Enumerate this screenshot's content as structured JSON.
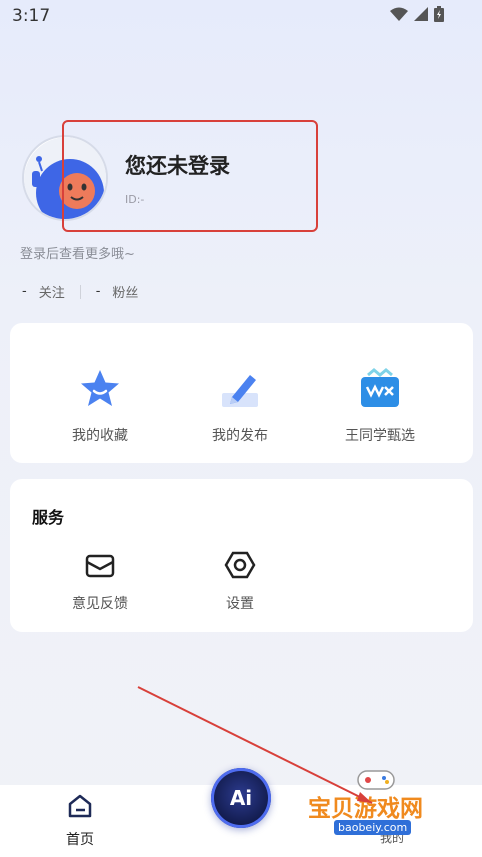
{
  "status_bar": {
    "time": "3:17"
  },
  "profile": {
    "name": "您还未登录",
    "id_label": "ID:-",
    "hint": "登录后查看更多哦~",
    "follow_count": "-",
    "follow_label": "关注",
    "fans_count": "-",
    "fans_label": "粉丝"
  },
  "quick_actions": [
    {
      "label": "我的收藏",
      "icon": "star-icon"
    },
    {
      "label": "我的发布",
      "icon": "pencil-icon"
    },
    {
      "label": "王同学甄选",
      "icon": "shopping-bag-icon"
    }
  ],
  "services": {
    "title": "服务",
    "items": [
      {
        "label": "意见反馈",
        "icon": "mail-icon"
      },
      {
        "label": "设置",
        "icon": "settings-icon"
      }
    ]
  },
  "bottom_nav": {
    "home_label": "首页",
    "ai_label": "Ai",
    "mine_label": "我的"
  },
  "watermark": {
    "text": "宝贝游戏网",
    "url": "baobeiy.com"
  },
  "colors": {
    "accent": "#4e6cf0",
    "annotation_red": "#d8403a",
    "watermark_orange": "#f08a1e"
  }
}
